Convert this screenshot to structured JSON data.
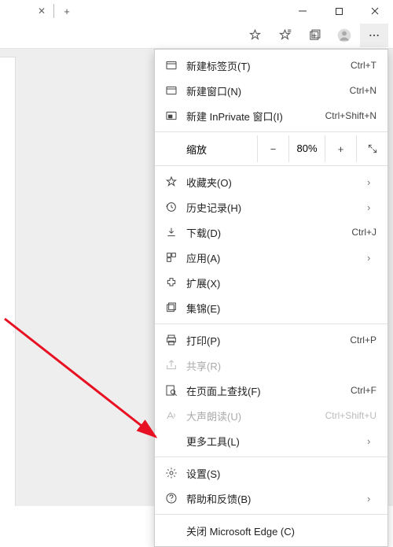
{
  "window": {
    "min": "–",
    "max": "☐",
    "close": "✕"
  },
  "tabs": {
    "close": "✕",
    "new": "+"
  },
  "toolbar": {
    "star_icon": "☆",
    "fav_icon": "✩",
    "collections_icon": "▣",
    "profile_icon": "◯",
    "more_icon": "⋯"
  },
  "menu": {
    "new_tab": {
      "label": "新建标签页(T)",
      "shortcut": "Ctrl+T"
    },
    "new_window": {
      "label": "新建窗口(N)",
      "shortcut": "Ctrl+N"
    },
    "new_inprivate": {
      "label": "新建 InPrivate 窗口(I)",
      "shortcut": "Ctrl+Shift+N"
    },
    "zoom": {
      "label": "缩放",
      "minus": "−",
      "value": "80%",
      "plus": "+",
      "full": "⤢"
    },
    "favorites": {
      "label": "收藏夹(O)"
    },
    "history": {
      "label": "历史记录(H)"
    },
    "downloads": {
      "label": "下载(D)",
      "shortcut": "Ctrl+J"
    },
    "apps": {
      "label": "应用(A)"
    },
    "extensions": {
      "label": "扩展(X)"
    },
    "collections": {
      "label": "集锦(E)"
    },
    "print": {
      "label": "打印(P)",
      "shortcut": "Ctrl+P"
    },
    "share": {
      "label": "共享(R)"
    },
    "find": {
      "label": "在页面上查找(F)",
      "shortcut": "Ctrl+F"
    },
    "read_aloud": {
      "label": "大声朗读(U)",
      "shortcut": "Ctrl+Shift+U"
    },
    "more_tools": {
      "label": "更多工具(L)"
    },
    "settings": {
      "label": "设置(S)"
    },
    "help": {
      "label": "帮助和反馈(B)"
    },
    "close_edge": {
      "label": "关闭 Microsoft Edge (C)"
    }
  }
}
